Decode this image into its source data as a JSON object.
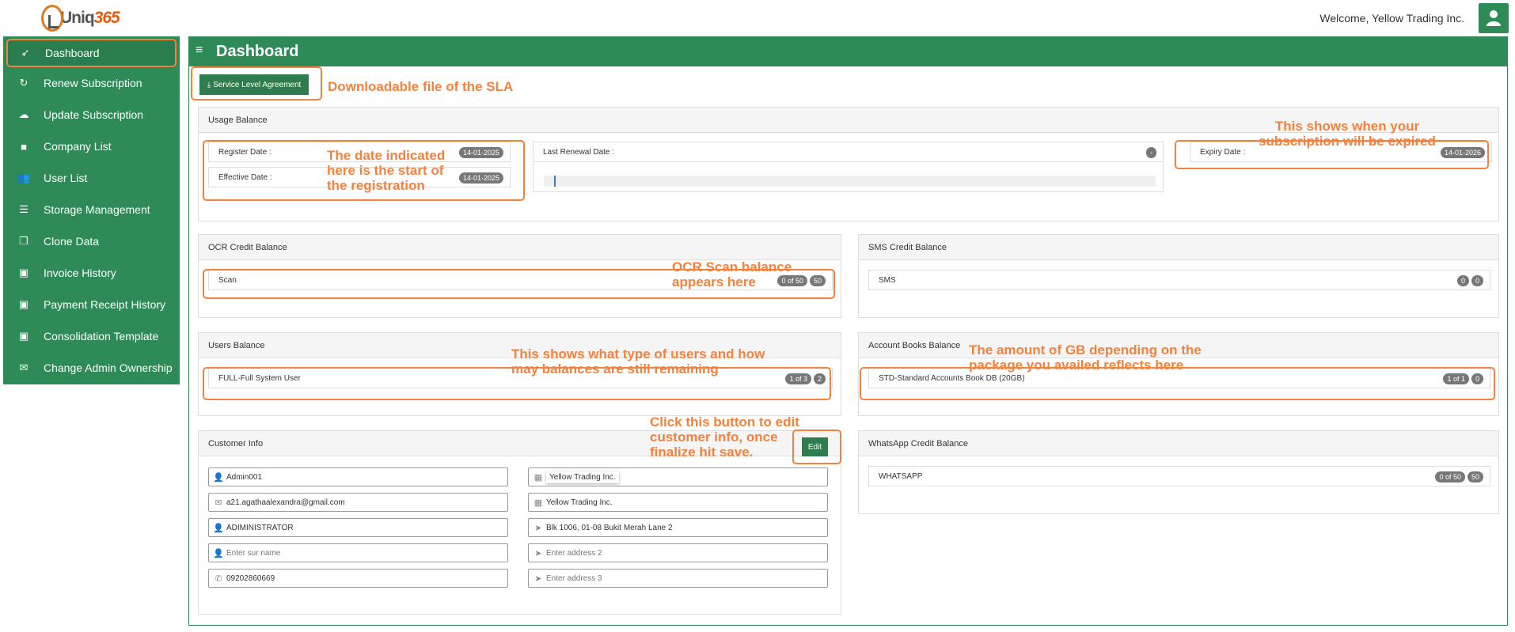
{
  "app": {
    "logo_text": "Uniq",
    "logo_num": "365",
    "welcome": "Welcome, Yellow Trading Inc."
  },
  "sidebar": {
    "items": [
      {
        "label": "Dashboard",
        "icon": "rocket-icon"
      },
      {
        "label": "Renew Subscription",
        "icon": "refresh-icon"
      },
      {
        "label": "Update Subscription",
        "icon": "cloud-upload-icon"
      },
      {
        "label": "Company List",
        "icon": "briefcase-icon"
      },
      {
        "label": "User List",
        "icon": "users-icon"
      },
      {
        "label": "Storage Management",
        "icon": "database-icon"
      },
      {
        "label": "Clone Data",
        "icon": "clone-icon"
      },
      {
        "label": "Invoice History",
        "icon": "money-icon"
      },
      {
        "label": "Payment Receipt History",
        "icon": "money-icon"
      },
      {
        "label": "Consolidation Template",
        "icon": "money-icon"
      },
      {
        "label": "Change Admin Ownership",
        "icon": "envelope-icon"
      }
    ]
  },
  "main": {
    "title": "Dashboard",
    "sla_button": "Service Level Agreement"
  },
  "usage": {
    "title": "Usage Balance",
    "register_label": "Register Date :",
    "register_date": "14-01-2025",
    "effective_label": "Effective Date :",
    "effective_date": "14-01-2025",
    "renewal_label": "Last Renewal Date :",
    "renewal_value": "-",
    "expiry_label": "Expiry Date :",
    "expiry_date": "14-01-2026"
  },
  "ocr": {
    "title": "OCR Credit Balance",
    "label": "Scan",
    "badge1": "0 of 50",
    "badge2": "50"
  },
  "sms": {
    "title": "SMS Credit Balance",
    "label": "SMS",
    "badge1": "0",
    "badge2": "0"
  },
  "users": {
    "title": "Users Balance",
    "label": "FULL-Full System User",
    "badge1": "1 of 3",
    "badge2": "2"
  },
  "books": {
    "title": "Account Books Balance",
    "label": "STD-Standard Accounts Book DB (20GB)",
    "badge1": "1 of 1",
    "badge2": "0"
  },
  "customer": {
    "title": "Customer Info",
    "edit_button": "Edit",
    "username": "Admin001",
    "email": "a21.agathaalexandra@gmail.com",
    "role": "ADIMINISTRATOR",
    "surname_placeholder": "Enter sur name",
    "phone": "09202860669",
    "company": "Yellow Trading Inc.",
    "company2": "Yellow Trading Inc.",
    "address1": "Blk 1006, 01-08 Bukit Merah Lane 2",
    "address2_placeholder": "Enter address 2",
    "address3_placeholder": "Enter address 3"
  },
  "whatsapp": {
    "title": "WhatsApp Credit Balance",
    "label": "WHATSAPP",
    "badge1": "0 of 50",
    "badge2": "50"
  },
  "annotations": {
    "sla": "Downloadable file of the SLA",
    "register": "The date indicated here is the start of the registration",
    "expiry": "This shows when your subscription will be expired",
    "ocr": "OCR Scan balance appears here",
    "users": "This shows what type of users and how may balances are still remaining",
    "books": "The amount of GB depending on the package you availed reflects here",
    "edit": "Click this button to edit customer info, once finalize hit save.",
    "accent_color": "#f5813d"
  },
  "colors": {
    "brand": "#2e8b57",
    "annotation": "#f5813d"
  }
}
